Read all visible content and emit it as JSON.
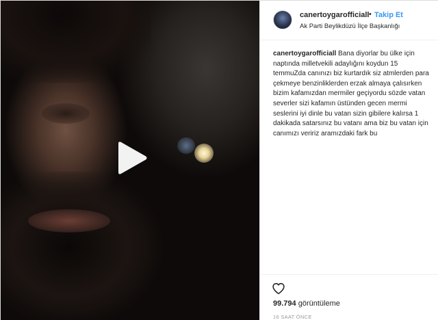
{
  "post": {
    "username": "canertoygarofficiall",
    "separator": "•",
    "follow_label": "Takip Et",
    "location": "Ak Parti Beylikdüzü İlçe Başkanlığı"
  },
  "caption": {
    "username": "canertoygarofficiall",
    "text": "Bana diyorlar bu ülke için naptında milletvekili adaylığını koydun 15 temmuZda canınızı biz kurtardık siz atmlerden para çekmeye benzinliklerden erzak almaya çalısırken bizim kafamızdan mermiler geçiyordu sözde vatan severler sizi kafamın üstünden gecen mermi seslerini iyi dinle bu vatan sizin gibilere kalırsa 1 dakikada satarsınız bu vatanı ama biz bu vatan için canımızı veririz aramızdaki fark bu"
  },
  "stats": {
    "view_count": "99.794",
    "view_label": "görüntüleme",
    "timestamp": "16 SAAT ÖNCE"
  },
  "icons": {
    "play": "play-icon",
    "like": "heart-icon"
  },
  "colors": {
    "accent": "#3897f0",
    "text": "#262626",
    "muted": "#999999"
  }
}
